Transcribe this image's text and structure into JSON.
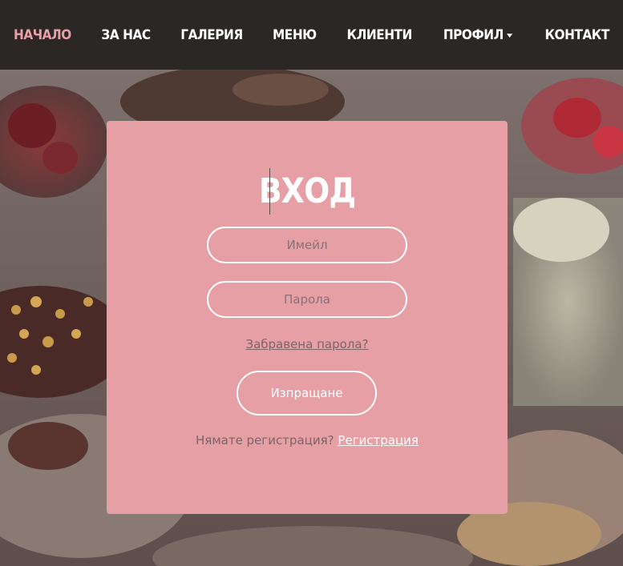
{
  "nav": {
    "items": [
      {
        "label": "НАЧАЛО",
        "active": true
      },
      {
        "label": "ЗА НАС",
        "active": false
      },
      {
        "label": "ГАЛЕРИЯ",
        "active": false
      },
      {
        "label": "МЕНЮ",
        "active": false
      },
      {
        "label": "КЛИЕНТИ",
        "active": false
      },
      {
        "label": "ПРОФИЛ",
        "active": false,
        "dropdown": true
      },
      {
        "label": "КОНТАКТ",
        "active": false
      }
    ]
  },
  "login": {
    "title": "ВХОД",
    "email_placeholder": "Имейл",
    "password_placeholder": "Парола",
    "forgot_label": "Забравена парола?",
    "submit_label": "Изпращане",
    "register_prompt": "Нямате регистрация?",
    "register_link": "Регистрация"
  },
  "colors": {
    "nav_background": "#2b2724",
    "active_nav": "#e8a0a6",
    "card_background": "#e69fa4",
    "text_white": "#ffffff"
  }
}
